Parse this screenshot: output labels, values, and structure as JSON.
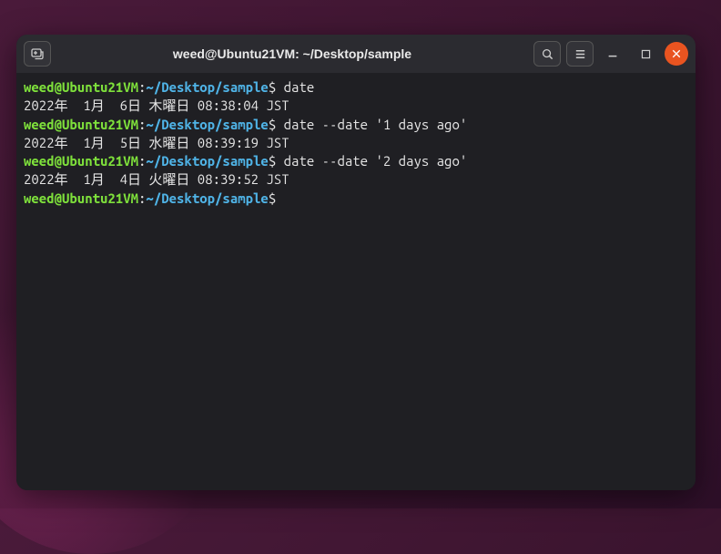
{
  "titlebar": {
    "title": "weed@Ubuntu21VM: ~/Desktop/sample"
  },
  "prompt": {
    "userhost": "weed@Ubuntu21VM",
    "colon": ":",
    "path": "~/Desktop/sample",
    "dollar": "$ "
  },
  "lines": [
    {
      "type": "cmd",
      "command": "date"
    },
    {
      "type": "out",
      "text": "2022年  1月  6日 木曜日 08:38:04 JST"
    },
    {
      "type": "cmd",
      "command": "date --date '1 days ago'"
    },
    {
      "type": "out",
      "text": "2022年  1月  5日 水曜日 08:39:19 JST"
    },
    {
      "type": "cmd",
      "command": "date --date '2 days ago'"
    },
    {
      "type": "out",
      "text": "2022年  1月  4日 火曜日 08:39:52 JST"
    },
    {
      "type": "cmd",
      "command": ""
    }
  ]
}
